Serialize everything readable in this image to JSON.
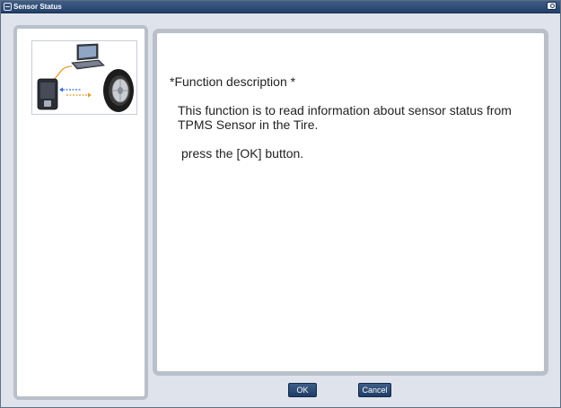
{
  "window": {
    "title": "Sensor Status",
    "title_icon": "app-icon",
    "close_icon": "close-icon"
  },
  "sidebar": {
    "illustration": {
      "icon": "tpms-diagnostic-illustration",
      "parts": [
        "laptop-icon",
        "scan-tool-icon",
        "tire-icon",
        "signal-arrow-icon"
      ]
    }
  },
  "content": {
    "title": "*Function description *",
    "body": "This function is to read information about sensor status from TPMS Sensor in the Tire.",
    "instruction": "press the [OK] button."
  },
  "buttons": {
    "ok_label": "OK",
    "cancel_label": "Cancel"
  },
  "colors": {
    "titlebar": "#2b4a75",
    "frame_border": "#b9c0ca",
    "button_bg": "#2d4d7a",
    "window_bg": "#dfe4ec"
  }
}
